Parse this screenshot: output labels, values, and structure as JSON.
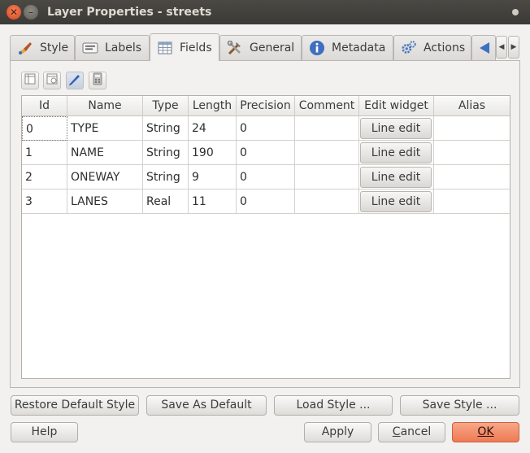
{
  "window": {
    "title": "Layer Properties - streets"
  },
  "tabs": [
    {
      "label": "Style",
      "icon": "brush-icon"
    },
    {
      "label": "Labels",
      "icon": "labels-icon"
    },
    {
      "label": "Fields",
      "icon": "table-icon",
      "active": true
    },
    {
      "label": "General",
      "icon": "tools-icon"
    },
    {
      "label": "Metadata",
      "icon": "info-icon"
    },
    {
      "label": "Actions",
      "icon": "gears-icon"
    }
  ],
  "toolbar": [
    {
      "name": "new-column-icon"
    },
    {
      "name": "delete-column-icon"
    },
    {
      "name": "edit-mode-icon"
    },
    {
      "name": "field-calculator-icon"
    }
  ],
  "table": {
    "columns": [
      "Id",
      "Name",
      "Type",
      "Length",
      "Precision",
      "Comment",
      "Edit widget",
      "Alias"
    ],
    "rows": [
      {
        "id": "0",
        "name": "TYPE",
        "type": "String",
        "length": "24",
        "precision": "0",
        "comment": "",
        "widget": "Line edit",
        "alias": ""
      },
      {
        "id": "1",
        "name": "NAME",
        "type": "String",
        "length": "190",
        "precision": "0",
        "comment": "",
        "widget": "Line edit",
        "alias": ""
      },
      {
        "id": "2",
        "name": "ONEWAY",
        "type": "String",
        "length": "9",
        "precision": "0",
        "comment": "",
        "widget": "Line edit",
        "alias": ""
      },
      {
        "id": "3",
        "name": "LANES",
        "type": "Real",
        "length": "11",
        "precision": "0",
        "comment": "",
        "widget": "Line edit",
        "alias": ""
      }
    ]
  },
  "style_buttons": {
    "restore": "Restore Default Style",
    "save_default": "Save As Default",
    "load": "Load Style ...",
    "save": "Save Style ..."
  },
  "dialog_buttons": {
    "help": "Help",
    "apply": "Apply",
    "cancel_mnemonic": "C",
    "cancel_rest": "ancel",
    "ok": "OK"
  }
}
